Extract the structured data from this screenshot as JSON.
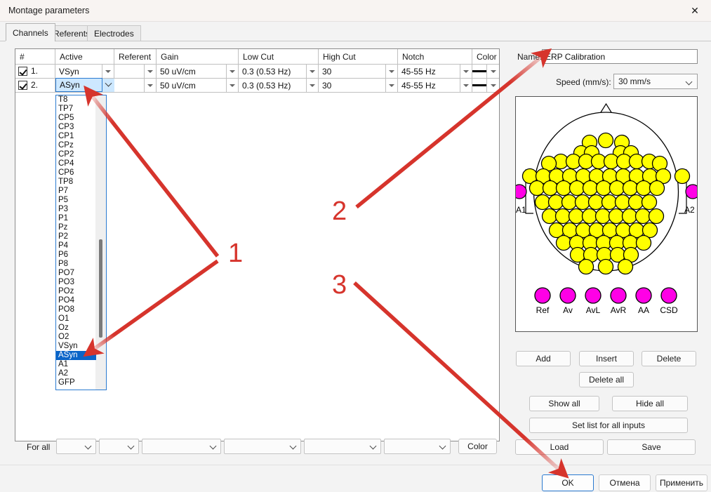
{
  "window": {
    "title": "Montage parameters",
    "close_icon": "close-icon",
    "close_label": "✕"
  },
  "tabs": [
    {
      "label": "Channels",
      "selected": true
    },
    {
      "label": "Referents",
      "selected": false
    },
    {
      "label": "Electrodes",
      "selected": false
    }
  ],
  "grid": {
    "columns": [
      "#",
      "Active",
      "Referent",
      "Gain",
      "Low Cut",
      "High Cut",
      "Notch",
      "Color"
    ],
    "rows": [
      {
        "checked": true,
        "number": "1.",
        "active": "VSyn",
        "referent": "",
        "gain": "50 uV/cm",
        "low_cut": "0.3   (0.53 Hz)",
        "high_cut": "30",
        "notch": "45-55 Hz",
        "color": "#000000",
        "active_focused": false
      },
      {
        "checked": true,
        "number": "2.",
        "active": "ASyn",
        "referent": "",
        "gain": "50 uV/cm",
        "low_cut": "0.3   (0.53 Hz)",
        "high_cut": "30",
        "notch": "45-55 Hz",
        "color": "#000000",
        "active_focused": true
      }
    ]
  },
  "dropdown": {
    "open": true,
    "selected": "ASyn",
    "items": [
      "T8",
      "TP7",
      "CP5",
      "CP3",
      "CP1",
      "CPz",
      "CP2",
      "CP4",
      "CP6",
      "TP8",
      "P7",
      "P5",
      "P3",
      "P1",
      "Pz",
      "P2",
      "P4",
      "P6",
      "P8",
      "PO7",
      "PO3",
      "POz",
      "PO4",
      "PO8",
      "O1",
      "Oz",
      "O2",
      "VSyn",
      "ASyn",
      "A1",
      "A2",
      "GFP"
    ]
  },
  "right_panel": {
    "name_label": "Name:",
    "name_value": "ERP Calibration",
    "speed_label": "Speed (mm/s):",
    "speed_value": "30 mm/s",
    "head_map": {
      "ear_left_label": "A1",
      "ear_right_label": "A2",
      "electrode_color": "#FFFF00",
      "special_color": "#FF00E6",
      "special_electrodes": [
        "Ref",
        "Av",
        "AvL",
        "AvR",
        "AA",
        "CSD"
      ]
    },
    "buttons": [
      "Add",
      "Insert",
      "Delete",
      "Delete all",
      "Show all",
      "Hide all",
      "Set list for all inputs",
      "Load",
      "Save"
    ]
  },
  "for_all": {
    "label": "For all",
    "selects": [
      "",
      "",
      "",
      "",
      "",
      ""
    ],
    "color_button": "Color"
  },
  "dialog_buttons": {
    "ok": "OK",
    "cancel": "Отмена",
    "apply": "Применить"
  },
  "annotations": {
    "accent_color": "#D6342C",
    "markers": [
      {
        "label": "1"
      },
      {
        "label": "2"
      },
      {
        "label": "3"
      }
    ]
  }
}
